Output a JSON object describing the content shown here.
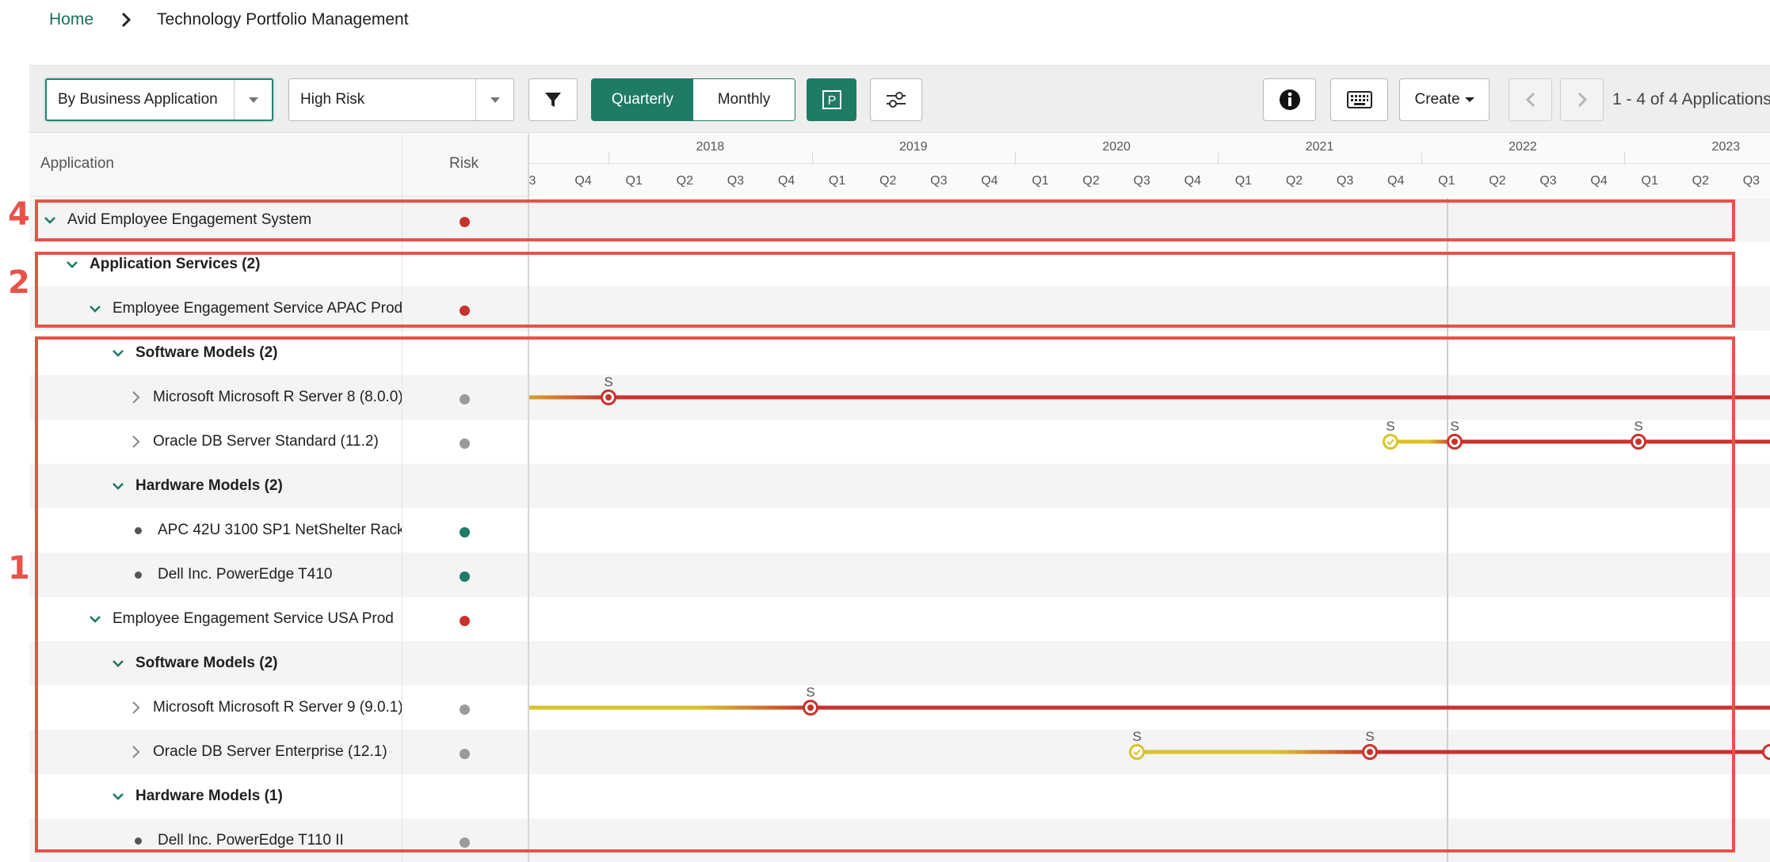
{
  "breadcrumb": {
    "home": "Home",
    "current": "Technology Portfolio Management"
  },
  "toolbar": {
    "group_by": "By Business Application",
    "risk_filter": "High Risk",
    "view_quarterly": "Quarterly",
    "view_monthly": "Monthly",
    "p_button": "P",
    "create": "Create",
    "pager": "1 - 4 of 4 Applications"
  },
  "columns": {
    "application": "Application",
    "risk": "Risk"
  },
  "timeline": {
    "years": [
      "2018",
      "2019",
      "2020",
      "2021",
      "2022",
      "2023"
    ],
    "quarters": [
      "3",
      "Q4",
      "Q1",
      "Q2",
      "Q3",
      "Q4",
      "Q1",
      "Q2",
      "Q3",
      "Q4",
      "Q1",
      "Q2",
      "Q3",
      "Q4",
      "Q1",
      "Q2",
      "Q3",
      "Q4",
      "Q1",
      "Q2",
      "Q3",
      "Q4",
      "Q1",
      "Q2",
      "Q3"
    ],
    "marker_letter": "S"
  },
  "rows": [
    {
      "label": "Avid Employee Engagement System",
      "risk": "red"
    },
    {
      "label": "Application Services (2)"
    },
    {
      "label": "Employee Engagement Service APAC Prod",
      "risk": "red"
    },
    {
      "label": "Software Models (2)"
    },
    {
      "label": "Microsoft Microsoft R Server 8 (8.0.0)",
      "risk": "gray"
    },
    {
      "label": "Oracle DB Server Standard (11.2)",
      "risk": "gray"
    },
    {
      "label": "Hardware Models (2)"
    },
    {
      "label": "APC 42U 3100 SP1 NetShelter Rack",
      "risk": "green"
    },
    {
      "label": "Dell Inc. PowerEdge T410",
      "risk": "green"
    },
    {
      "label": "Employee Engagement Service USA Prod",
      "risk": "red"
    },
    {
      "label": "Software Models (2)"
    },
    {
      "label": "Microsoft Microsoft R Server 9 (9.0.1)",
      "risk": "gray"
    },
    {
      "label": "Oracle DB Server Enterprise (12.1)",
      "risk": "gray"
    },
    {
      "label": "Hardware Models (1)"
    },
    {
      "label": "Dell Inc. PowerEdge T110 II",
      "risk": "gray"
    }
  ],
  "colors": {
    "red": "#c8322d",
    "gray": "#9a9a9a",
    "green": "#1f7a66",
    "yellow": "#d9c22a",
    "accent": "#1f7a66",
    "annotation": "#e8524a"
  },
  "annotations": [
    "4",
    "2",
    "1"
  ]
}
